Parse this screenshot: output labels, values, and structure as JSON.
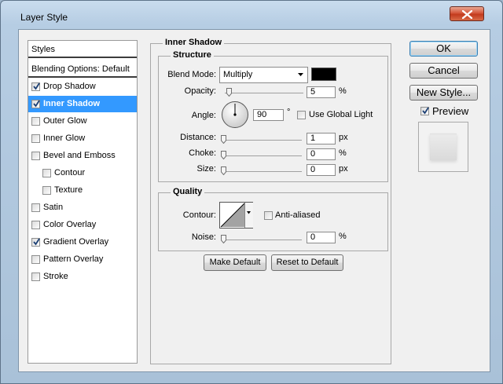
{
  "window": {
    "title": "Layer Style"
  },
  "sidebar": {
    "header": "Styles",
    "blending_options": "Blending Options: Default",
    "items": [
      {
        "label": "Drop Shadow",
        "checked": true
      },
      {
        "label": "Inner Shadow",
        "checked": true,
        "selected": true
      },
      {
        "label": "Outer Glow",
        "checked": false
      },
      {
        "label": "Inner Glow",
        "checked": false
      },
      {
        "label": "Bevel and Emboss",
        "checked": false
      },
      {
        "label": "Contour",
        "checked": false
      },
      {
        "label": "Texture",
        "checked": false
      },
      {
        "label": "Satin",
        "checked": false
      },
      {
        "label": "Color Overlay",
        "checked": false
      },
      {
        "label": "Gradient Overlay",
        "checked": true
      },
      {
        "label": "Pattern Overlay",
        "checked": false
      },
      {
        "label": "Stroke",
        "checked": false
      }
    ]
  },
  "panel": {
    "title": "Inner Shadow",
    "structure": {
      "title": "Structure",
      "blend_mode_label": "Blend Mode:",
      "blend_mode_value": "Multiply",
      "blend_color": "#000000",
      "opacity_label": "Opacity:",
      "opacity_value": "5",
      "opacity_unit": "%",
      "opacity_fraction": 0.05,
      "angle_label": "Angle:",
      "angle_value": "90",
      "angle_unit": "°",
      "use_global_light_label": "Use Global Light",
      "use_global_light": false,
      "distance_label": "Distance:",
      "distance_value": "1",
      "distance_unit": "px",
      "choke_label": "Choke:",
      "choke_value": "0",
      "choke_unit": "%",
      "size_label": "Size:",
      "size_value": "0",
      "size_unit": "px"
    },
    "quality": {
      "title": "Quality",
      "contour_label": "Contour:",
      "anti_aliased_label": "Anti-aliased",
      "anti_aliased": false,
      "noise_label": "Noise:",
      "noise_value": "0",
      "noise_unit": "%"
    },
    "make_default": "Make Default",
    "reset_default": "Reset to Default"
  },
  "buttons": {
    "ok": "OK",
    "cancel": "Cancel",
    "new_style": "New Style...",
    "preview_label": "Preview",
    "preview_checked": true
  }
}
